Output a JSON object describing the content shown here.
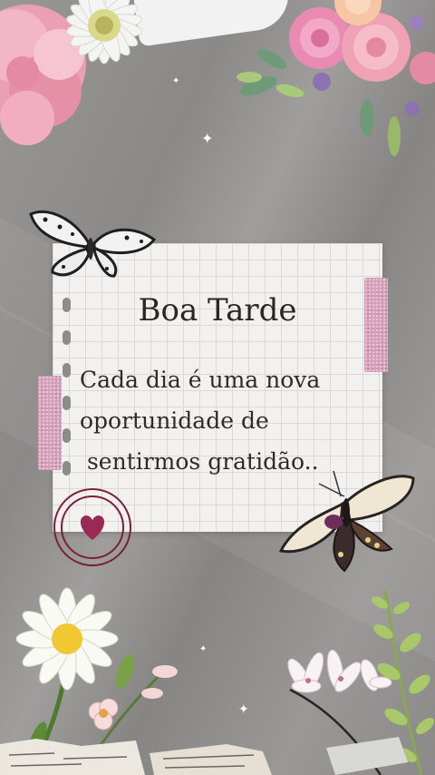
{
  "card": {
    "title": "Boa Tarde",
    "lines": [
      "Cada dia é uma nova",
      "oportunidade de",
      " sentirmos gratidão.."
    ]
  },
  "colors": {
    "background": "#8e8c8b",
    "paper": "#f2f1f0",
    "accent": "#7a1f3d"
  },
  "decorations": [
    "carnation",
    "daisy",
    "roses",
    "butterfly",
    "swallowtail-butterfly",
    "heart-badge",
    "glitter-tape",
    "magnolia",
    "fern",
    "newspaper-scraps"
  ]
}
